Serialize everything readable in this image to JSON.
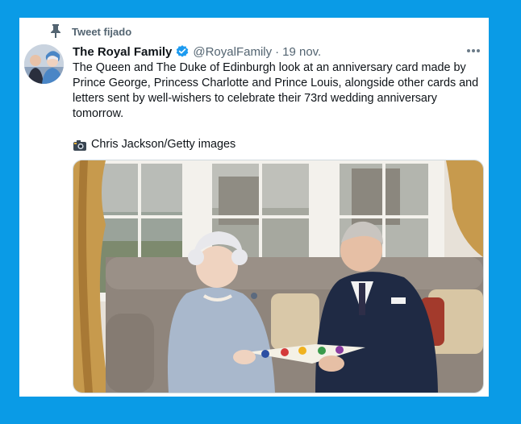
{
  "pinned": {
    "label": "Tweet fijado",
    "icon": "pin-icon"
  },
  "tweet": {
    "display_name": "The Royal Family",
    "verified_icon": "verified-badge-icon",
    "handle": "@RoyalFamily",
    "separator": "·",
    "date": "19 nov.",
    "more_icon": "more-options-icon",
    "text": "The Queen and The Duke of Edinburgh look at an anniversary card made by Prince George, Princess Charlotte and Prince Louis, alongside other cards and letters sent by well-wishers to celebrate their 73rd wedding anniversary tomorrow.",
    "credit_icon": "camera-icon",
    "credit": "Chris Jackson/Getty images",
    "media": "photo-of-couple-reading-card"
  },
  "colors": {
    "background": "#0a9be6",
    "verified": "#1d9bf0",
    "secondary_text": "#536471",
    "primary_text": "#0f1419"
  }
}
